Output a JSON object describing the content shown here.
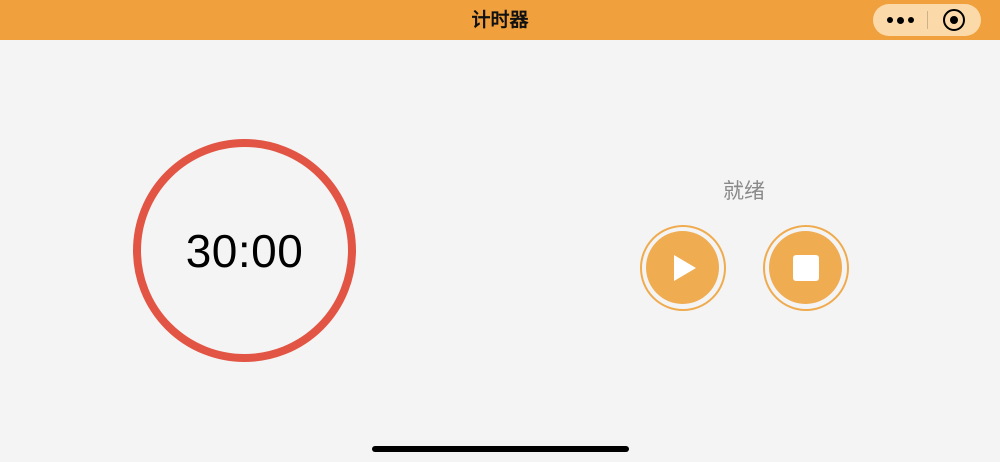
{
  "navbar": {
    "title": "计时器",
    "background_color": "#f0a03c",
    "capsule": {
      "more_icon": "more-dots-icon",
      "close_icon": "target-circle-icon"
    }
  },
  "timer": {
    "display": "30:00",
    "ring_color": "#e25544"
  },
  "status": {
    "label": "就绪"
  },
  "controls": {
    "play_icon": "play-icon",
    "stop_icon": "stop-icon",
    "accent_color": "#f0ac50"
  }
}
